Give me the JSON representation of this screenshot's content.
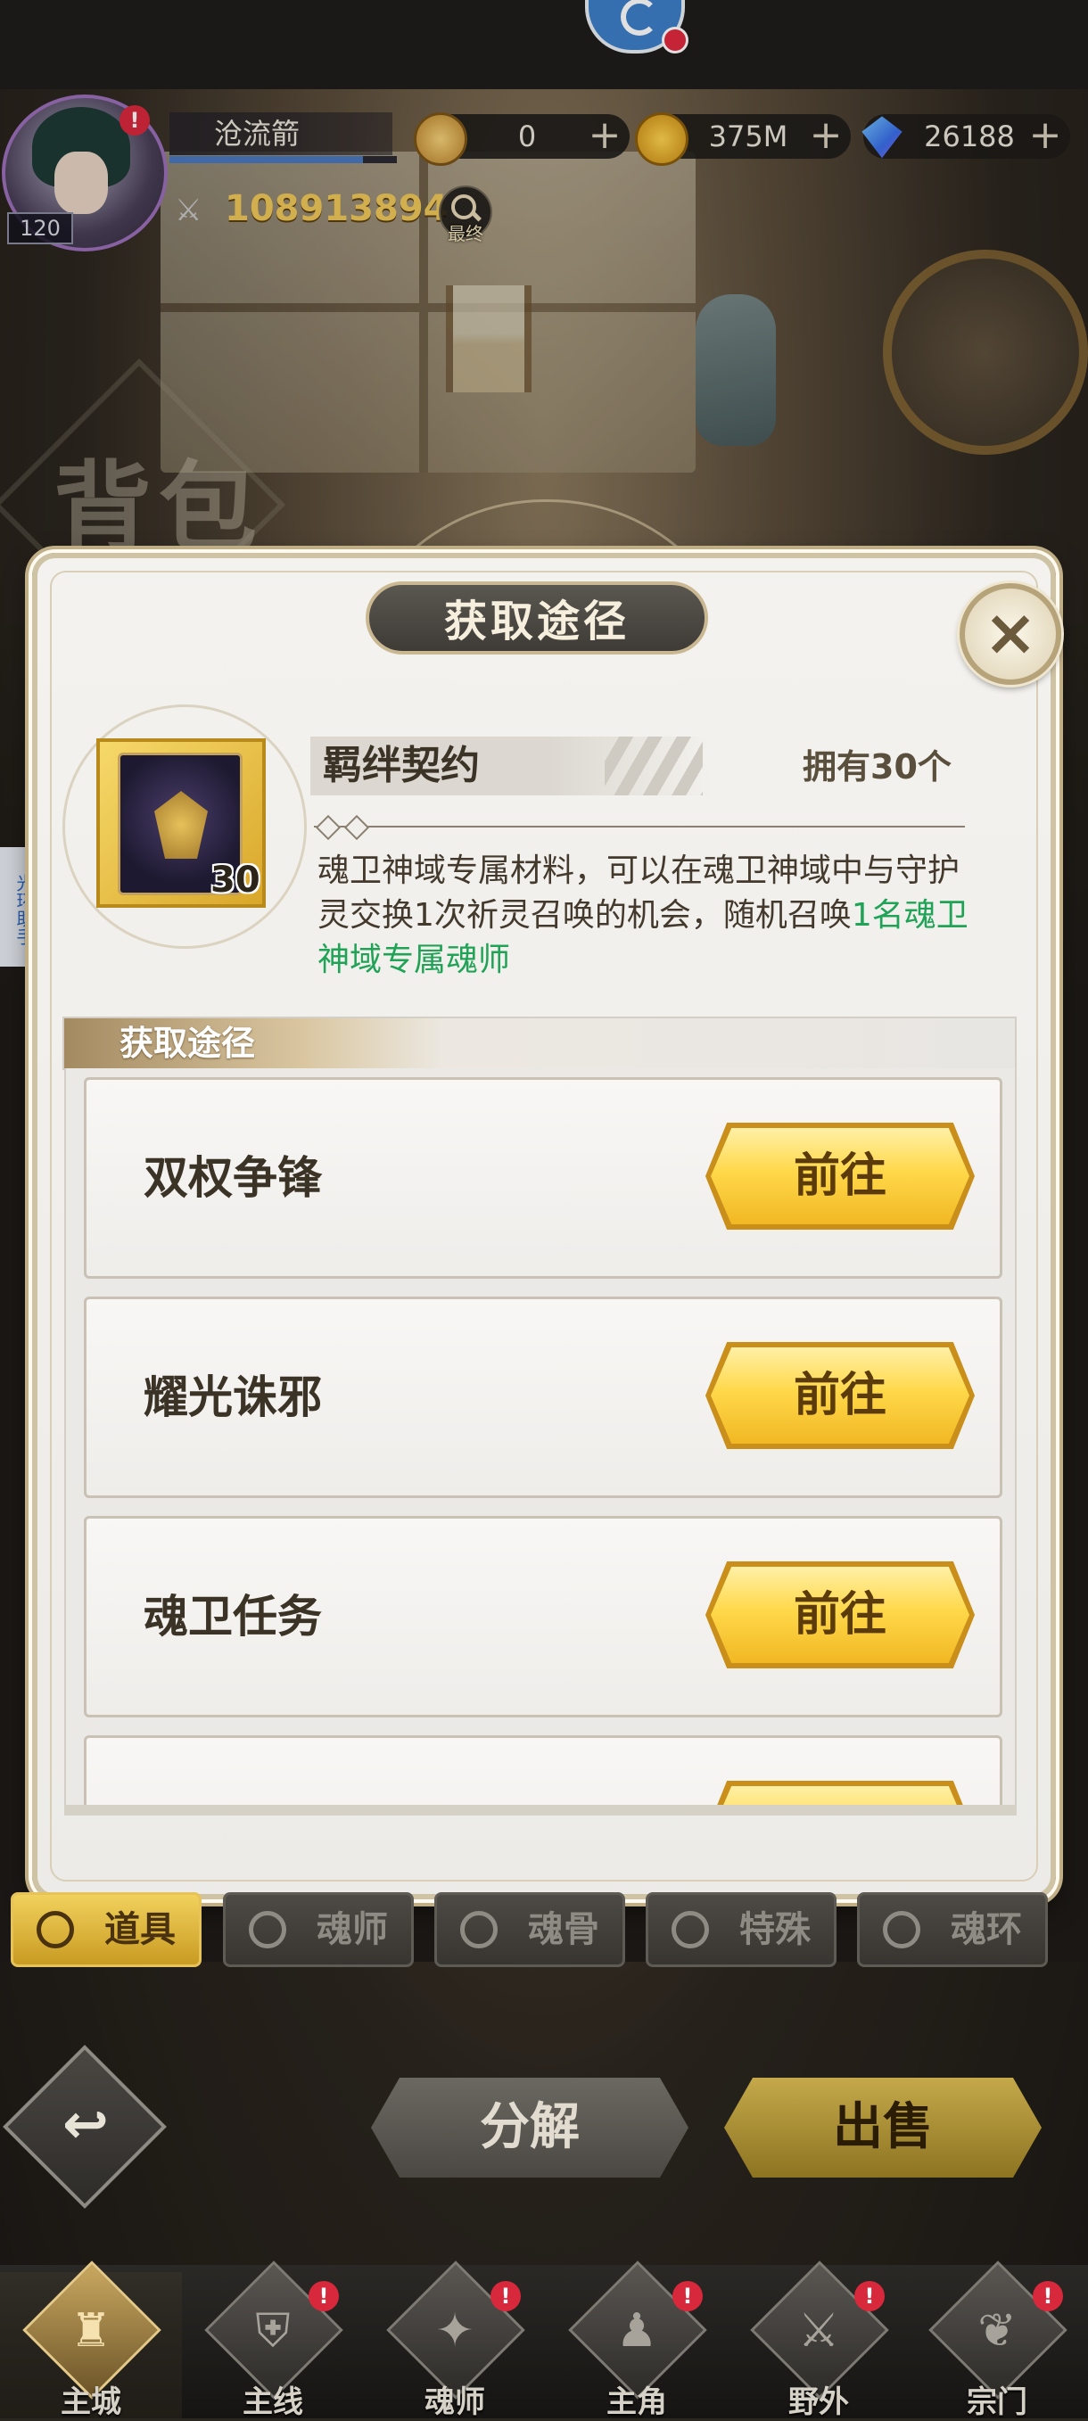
{
  "header": {
    "player_name": "沧流箭",
    "level": "120",
    "avatar_alert": "!",
    "power": "108913894",
    "search_tag": "最终",
    "xp_progress": 0.85,
    "currencies": [
      {
        "icon": "token-coin-icon",
        "value": "0",
        "plus": "+"
      },
      {
        "icon": "gold-coin-icon",
        "value": "375M",
        "plus": "+"
      },
      {
        "icon": "diamond-icon",
        "value": "26188",
        "plus": "+"
      }
    ]
  },
  "page_title": "背包",
  "side_helper": "光环助手",
  "modal": {
    "title": "获取途径",
    "close_icon": "×",
    "item": {
      "name": "羁绊契约",
      "count": "30",
      "owned": "拥有30个",
      "desc_prefix": "魂卫神域专属材料，可以在魂卫神域中与守护灵交换1次祈灵召唤的机会，随机召唤",
      "desc_highlight": "1名魂卫神域专属魂师",
      "highlight_color": "#20a356"
    },
    "section_label": "获取途径",
    "sources": [
      {
        "label": "双权争锋",
        "button": "前往"
      },
      {
        "label": "耀光诛邪",
        "button": "前往"
      },
      {
        "label": "魂卫任务",
        "button": "前往"
      }
    ]
  },
  "category_tabs": [
    {
      "label": "道具",
      "icon": "item-icon",
      "active": true
    },
    {
      "label": "魂师",
      "icon": "soul-master-icon",
      "active": false
    },
    {
      "label": "魂骨",
      "icon": "soul-bone-icon",
      "active": false
    },
    {
      "label": "特殊",
      "icon": "special-icon",
      "active": false
    },
    {
      "label": "魂环",
      "icon": "soul-ring-icon",
      "active": false
    }
  ],
  "actions": {
    "back_icon": "↩",
    "decompose": "分解",
    "sell": "出售"
  },
  "bottom_nav": [
    {
      "label": "主城",
      "icon": "castle-icon",
      "alert": "",
      "active": true
    },
    {
      "label": "主线",
      "icon": "mainline-icon",
      "alert": "!",
      "active": false
    },
    {
      "label": "魂师",
      "icon": "book-icon",
      "alert": "!",
      "active": false
    },
    {
      "label": "主角",
      "icon": "hero-icon",
      "alert": "!",
      "active": false
    },
    {
      "label": "野外",
      "icon": "sword-icon",
      "alert": "!",
      "active": false
    },
    {
      "label": "宗门",
      "icon": "sect-icon",
      "alert": "!",
      "active": false
    }
  ],
  "colors": {
    "accent_gold": "#f1d15c",
    "alert_red": "#d8283c",
    "modal_bg": "#f4f2ee"
  }
}
